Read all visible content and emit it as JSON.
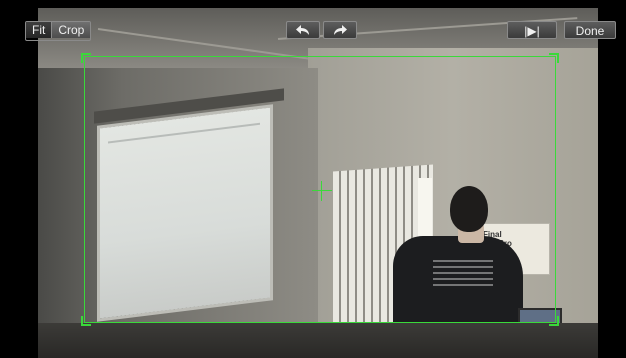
{
  "toolbar": {
    "fit_label": "Fit",
    "crop_label": "Crop",
    "rotate_left_icon": "rotate-left-arrow",
    "rotate_right_icon": "rotate-right-arrow",
    "play_label": "|▶|",
    "done_label": "Done",
    "active_mode": "Crop"
  },
  "viewer": {
    "poster_text": "Final Cut Pro",
    "crop_color": "#3ad93a"
  }
}
